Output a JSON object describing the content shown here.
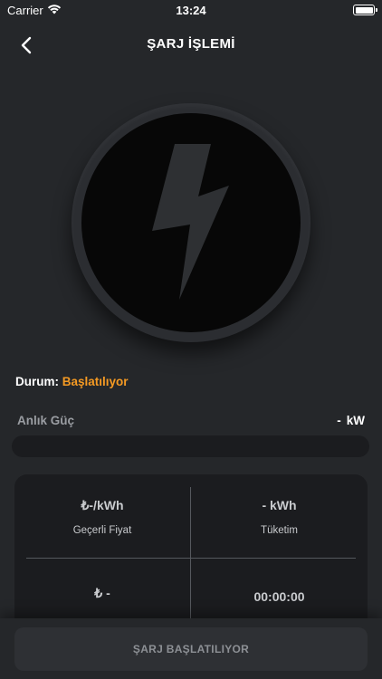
{
  "status_bar": {
    "carrier": "Carrier",
    "time": "13:24",
    "icons": [
      "wifi-icon",
      "battery-icon"
    ]
  },
  "nav": {
    "back_icon": "chevron-left-icon",
    "title": "ŞARJ İŞLEMİ"
  },
  "charger": {
    "icon": "lightning-bolt-icon",
    "colors": {
      "ring": "#2b2d31",
      "disc": "#070707",
      "bolt": "#2e3033"
    }
  },
  "status": {
    "label": "Durum:",
    "value": "Başlatılıyor",
    "value_color": "#f59a23"
  },
  "instant_power": {
    "label": "Anlık Güç",
    "value": "-",
    "unit": "kW",
    "progress_fraction": 0
  },
  "metrics": {
    "price_value": "₺-/kWh",
    "price_label": "Geçerli Fiyat",
    "consumption_value": "- kWh",
    "consumption_label": "Tüketim",
    "cost_value": "₺ -",
    "duration_value": "00:00:00"
  },
  "action": {
    "button_label": "ŞARJ BAŞLATILIYOR"
  }
}
